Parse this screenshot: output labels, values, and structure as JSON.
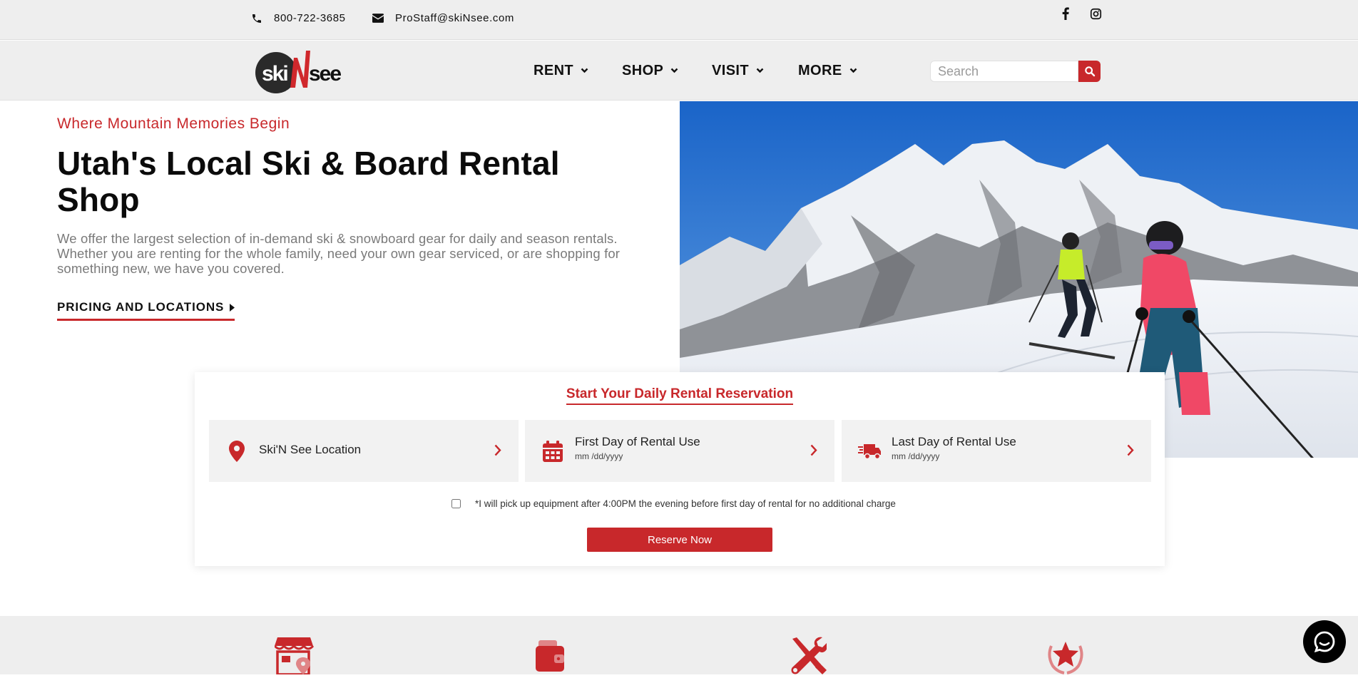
{
  "topbar": {
    "phone": "800-722-3685",
    "email": "ProStaff@skiNsee.com",
    "social": [
      "facebook-icon",
      "instagram-icon"
    ]
  },
  "header": {
    "logo_text": "skiNsee",
    "nav": [
      {
        "label": "RENT"
      },
      {
        "label": "SHOP"
      },
      {
        "label": "VISIT"
      },
      {
        "label": "MORE"
      }
    ],
    "search": {
      "placeholder": "Search"
    }
  },
  "hero": {
    "tagline": "Where Mountain Memories Begin",
    "title": "Utah's Local Ski & Board Rental Shop",
    "text": "We offer the largest selection of in-demand ski & snowboard gear for daily and season rentals. Whether you are renting for the whole family, need your own gear serviced, or are shopping for something new, we have you covered.",
    "link": "PRICING AND LOCATIONS"
  },
  "reservation": {
    "title": "Start Your Daily Rental Reservation",
    "fields": [
      {
        "label": "Ski'N See Location",
        "sub": "",
        "icon": "map-pin-icon"
      },
      {
        "label": "First Day of Rental Use",
        "sub": "mm /dd/yyyy",
        "icon": "calendar-icon"
      },
      {
        "label": "Last Day of Rental Use",
        "sub": "mm /dd/yyyy",
        "icon": "delivery-truck-icon"
      }
    ],
    "pickup_text": "*I will pick up equipment after 4:00PM the evening before first day of rental for no additional charge",
    "pickup_checked": false,
    "reserve_label": "Reserve Now"
  },
  "features": [
    "store-location-icon",
    "wallet-icon",
    "tools-icon",
    "award-star-icon"
  ],
  "colors": {
    "accent": "#c8282b",
    "bar": "#eeeeee",
    "box": "#f2f2f2"
  }
}
